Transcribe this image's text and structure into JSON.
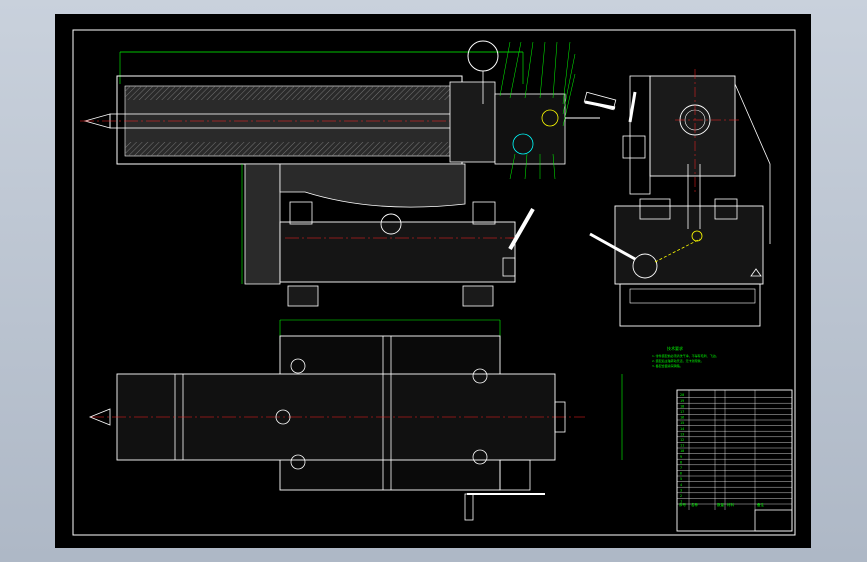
{
  "colors": {
    "background_outer": "#b8c2cf",
    "drawing_background": "#000000",
    "outline": "#ffffff",
    "dimension": "#00ff00",
    "centerline": "#ff2020",
    "hidden_line": "#ffff00",
    "accent": "#00ffff",
    "section_fill": "#3a3a3a"
  },
  "tech_notes": {
    "title": "技术要求",
    "lines": [
      "1.零件装配前必须清洗干净，不得有毛刺、飞边。",
      "2.装配后主轴转动灵活，无卡滞现象。",
      "3.各配合面涂润滑脂。"
    ]
  },
  "parts_table": {
    "rows": [
      [
        "20",
        "",
        "",
        "",
        ""
      ],
      [
        "19",
        "",
        "",
        "",
        ""
      ],
      [
        "18",
        "",
        "",
        "",
        ""
      ],
      [
        "17",
        "",
        "",
        "",
        ""
      ],
      [
        "16",
        "",
        "",
        "",
        ""
      ],
      [
        "15",
        "",
        "",
        "",
        ""
      ],
      [
        "14",
        "",
        "",
        "",
        ""
      ],
      [
        "13",
        "",
        "",
        "",
        ""
      ],
      [
        "12",
        "",
        "",
        "",
        ""
      ],
      [
        "11",
        "",
        "",
        "",
        ""
      ],
      [
        "10",
        "",
        "",
        "",
        ""
      ],
      [
        "9",
        "",
        "",
        "",
        ""
      ],
      [
        "8",
        "",
        "",
        "",
        ""
      ],
      [
        "7",
        "",
        "",
        "",
        ""
      ],
      [
        "6",
        "",
        "",
        "",
        ""
      ],
      [
        "5",
        "",
        "",
        "",
        ""
      ],
      [
        "4",
        "",
        "",
        "",
        ""
      ],
      [
        "3",
        "",
        "",
        "",
        ""
      ],
      [
        "2",
        "",
        "",
        "",
        ""
      ],
      [
        "1",
        "",
        "",
        "",
        ""
      ]
    ],
    "header": [
      "序号",
      "名称",
      "数量",
      "材料",
      "备注"
    ]
  }
}
